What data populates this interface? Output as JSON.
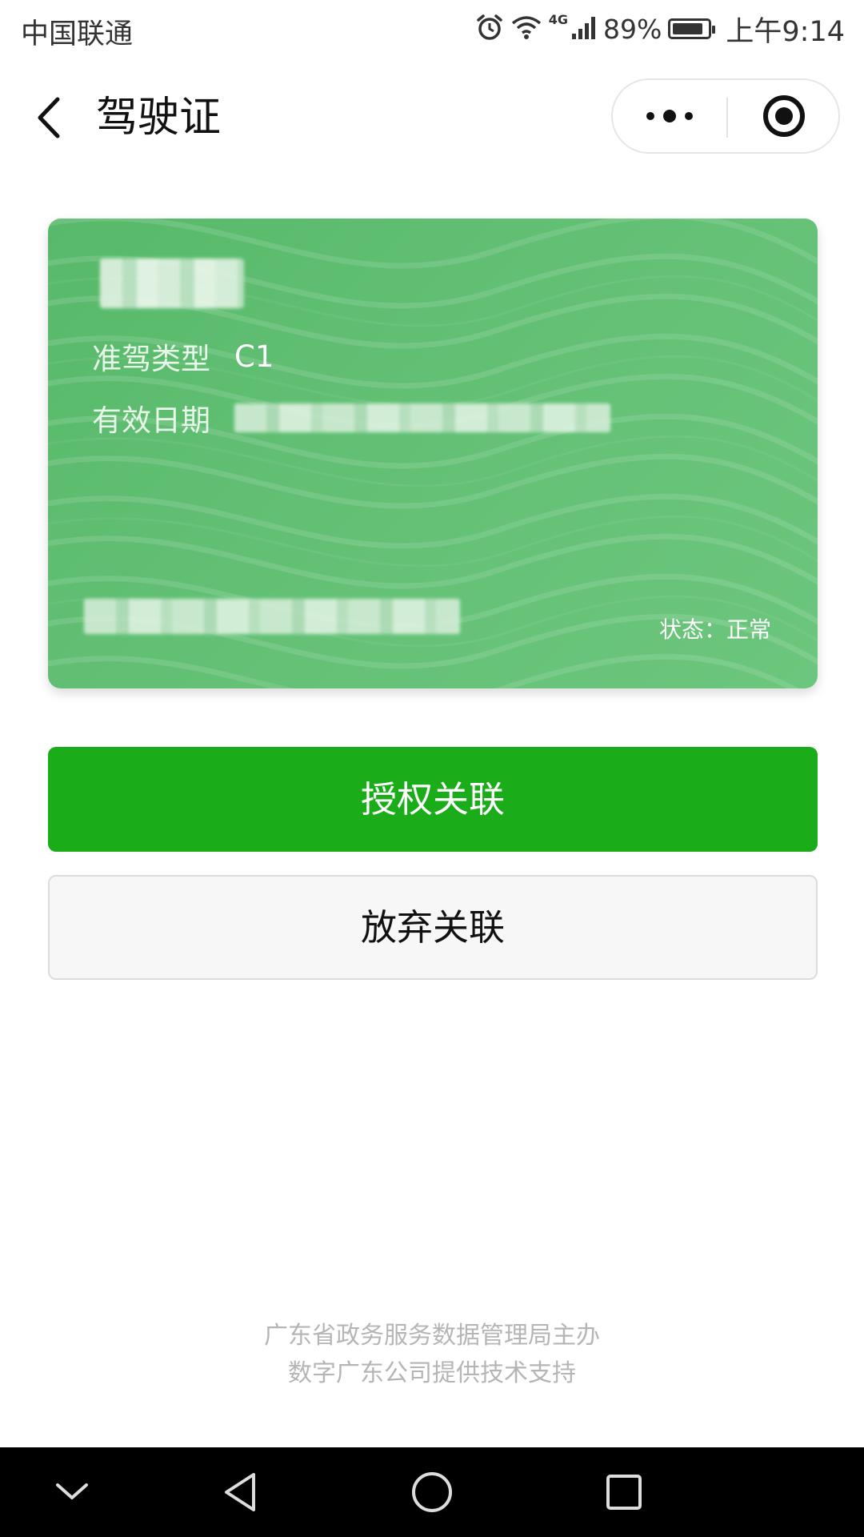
{
  "status_bar": {
    "carrier": "中国联通",
    "network": "4G",
    "battery": "89%",
    "battery_level": 0.89,
    "time": "上午9:14",
    "icons": [
      "alarm-icon",
      "wifi-icon",
      "signal-icon",
      "battery-icon"
    ]
  },
  "nav": {
    "title": "驾驶证",
    "icons": [
      "back-icon",
      "more-icon",
      "close-icon"
    ]
  },
  "card": {
    "license_class_label": "准驾类型",
    "license_class_value": "C1",
    "valid_date_label": "有效日期",
    "status_text": "状态：正常",
    "colors": {
      "card_green": "#62c074"
    }
  },
  "actions": {
    "authorize_label": "授权关联",
    "cancel_label": "放弃关联"
  },
  "footer": {
    "line1": "广东省政务服务数据管理局主办",
    "line2": "数字广东公司提供技术支持"
  },
  "system_nav": {
    "icons": [
      "collapse-icon",
      "back-triangle-icon",
      "home-circle-icon",
      "recents-square-icon"
    ]
  },
  "colors": {
    "primary_green": "#1aad19"
  }
}
